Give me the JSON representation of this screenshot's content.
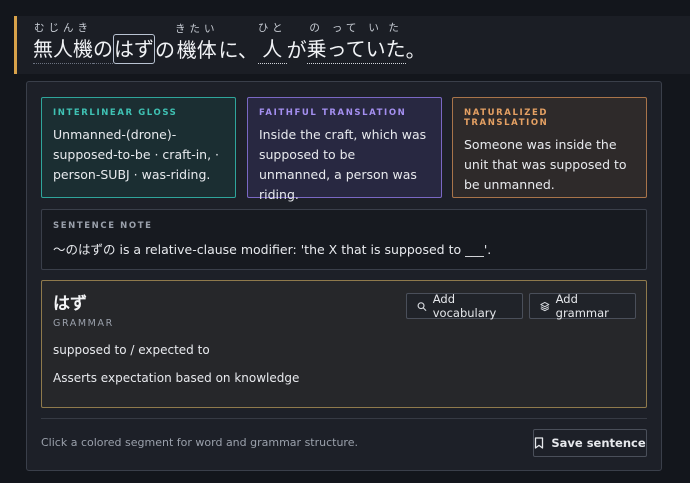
{
  "sentence": {
    "segments": [
      {
        "reading": "むじんき",
        "base": "無人機"
      },
      {
        "base": "の"
      },
      {
        "base": "はず"
      },
      {
        "base": "の"
      },
      {
        "reading": "きたい",
        "base": "機体"
      },
      {
        "base": "に、"
      },
      {
        "reading": "ひと",
        "base": "人"
      },
      {
        "base": "が"
      },
      {
        "reading": "の",
        "base": "乗"
      },
      {
        "reading": "って",
        "base": "って"
      },
      {
        "reading": "い",
        "base": "い"
      },
      {
        "reading": "た",
        "base": "た"
      },
      {
        "base": "。"
      }
    ]
  },
  "cards": {
    "gloss": {
      "title": "INTERLINEAR GLOSS",
      "text": "Unmanned-(drone)-supposed-to-be · craft-in, · person-SUBJ · was-riding."
    },
    "faithful": {
      "title": "FAITHFUL TRANSLATION",
      "text": "Inside the craft, which was supposed to be unmanned, a person was riding."
    },
    "naturalized": {
      "title": "NATURALIZED TRANSLATION",
      "text": "Someone was inside the unit that was supposed to be unmanned."
    }
  },
  "note": {
    "title": "SENTENCE NOTE",
    "text": "〜のはずの is a relative-clause modifier: 'the X that is supposed to ___'."
  },
  "grammar": {
    "word": "はず",
    "type": "GRAMMAR",
    "meaning": "supposed to / expected to",
    "description": "Asserts expectation based on knowledge",
    "add_vocab_label": "Add vocabulary",
    "add_grammar_label": "Add grammar"
  },
  "footer": {
    "hint": "Click a colored segment for word and grammar structure.",
    "save_label": "Save sentence"
  },
  "colors": {
    "accent_bar": "#d8a24a",
    "gloss": "#2fa59b",
    "faithful": "#7a68c4",
    "naturalized": "#a8744a",
    "grammar_border": "#8f7a4c"
  }
}
